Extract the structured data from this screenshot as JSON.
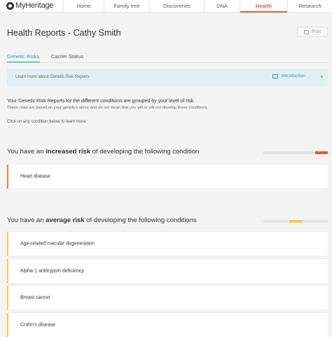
{
  "nav": {
    "logo_text": "MyHeritage",
    "items": [
      {
        "label": "Home"
      },
      {
        "label": "Family tree"
      },
      {
        "label": "Discoveries"
      },
      {
        "label": "DNA"
      },
      {
        "label": "Health"
      },
      {
        "label": "Research"
      }
    ],
    "active": "Health"
  },
  "header": {
    "title": "Health Reports - Cathy Smith",
    "print_label": "Print"
  },
  "tabs": [
    {
      "label": "Genetic Risks",
      "active": true
    },
    {
      "label": "Carrier Status",
      "active": false
    }
  ],
  "info_bar": {
    "text": "Learn more about Genetic Risk Reports",
    "link_label": "Introduction",
    "close": "×"
  },
  "intro": {
    "line1": "Your Genetic Risk Reports for the different conditions are grouped by your level of risk.",
    "line2": "These risks are based on your genetics alone and do not mean that you will or will not develop these conditions.",
    "line3": "Click on any condition below to learn more"
  },
  "sections": {
    "increased": {
      "prefix": "You have an ",
      "emphasis": "increased risk",
      "suffix": " of developing the following condition",
      "level_color": "#e5593a",
      "level_index": 4,
      "conditions": [
        "Heart disease"
      ]
    },
    "average": {
      "prefix": "You have an ",
      "emphasis": "average risk",
      "suffix": " of developing the following conditions",
      "level_color": "#f3d24d",
      "level_index": 2,
      "conditions": [
        "Age-related macular degeneration",
        "Alpha-1 antitrypsin deficiency",
        "Breast cancer",
        "Crohn's disease"
      ]
    }
  },
  "colors": {
    "accent": "#e5593a",
    "teal": "#1aa3a3",
    "info_bg": "#dff0f3",
    "increased": "#e8826b",
    "average": "#f3d24d"
  }
}
